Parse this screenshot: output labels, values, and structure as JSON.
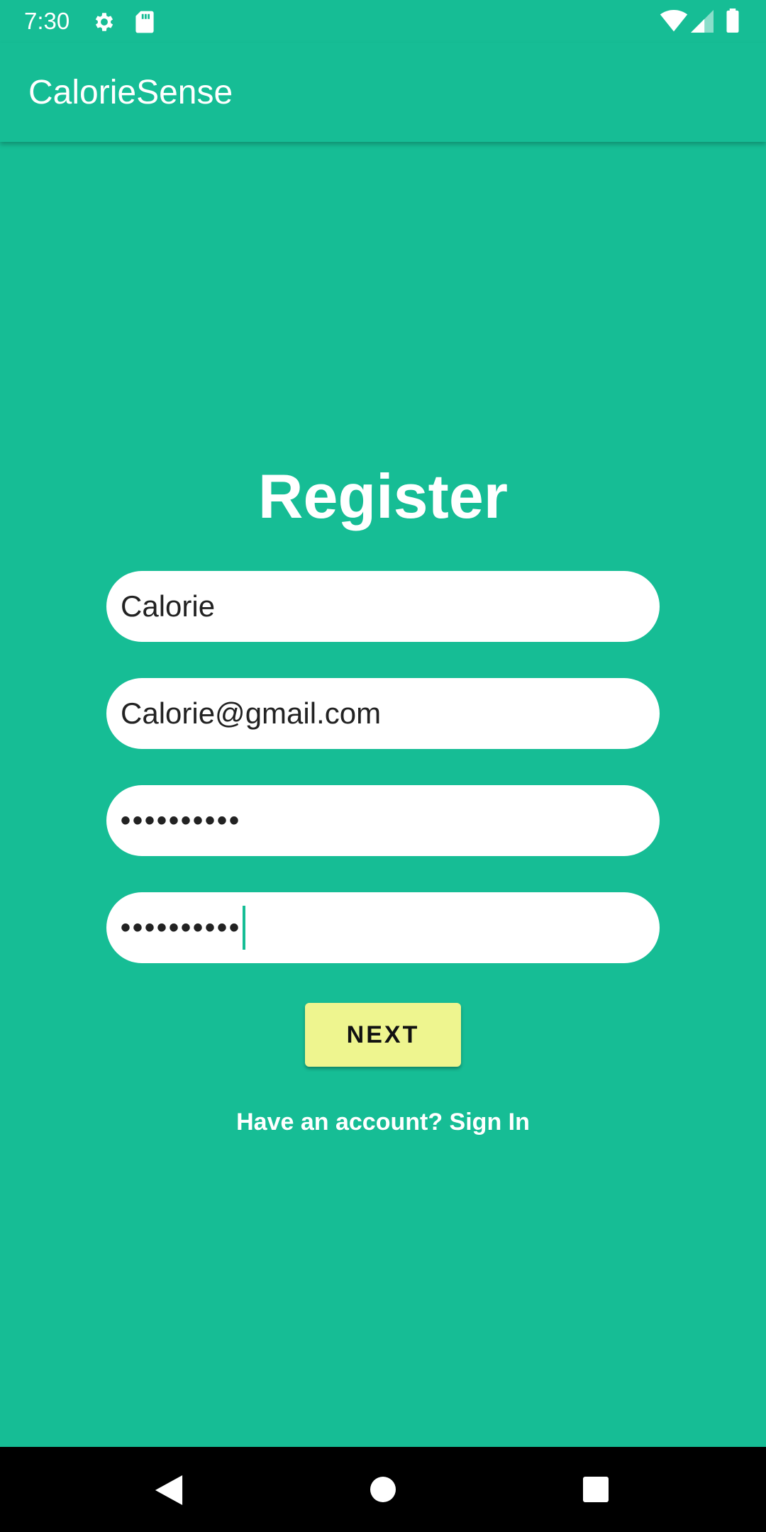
{
  "status_bar": {
    "time": "7:30",
    "icons": [
      "gear-icon",
      "sd-card-icon",
      "wifi-icon",
      "signal-icon",
      "battery-icon"
    ]
  },
  "app_bar": {
    "title": "CalorieSense"
  },
  "form": {
    "title": "Register",
    "name_value": "Calorie",
    "email_value": "Calorie@gmail.com",
    "password_value": "••••••••••",
    "confirm_password_value": "••••••••••",
    "next_label": "NEXT",
    "sign_in_text": "Have an account? Sign In"
  },
  "nav_bar": {
    "icons": [
      "back-icon",
      "home-icon",
      "recents-icon"
    ]
  },
  "colors": {
    "background": "#16bd95",
    "button": "#eef58f",
    "field": "#ffffff",
    "text_on_primary": "#ffffff"
  }
}
